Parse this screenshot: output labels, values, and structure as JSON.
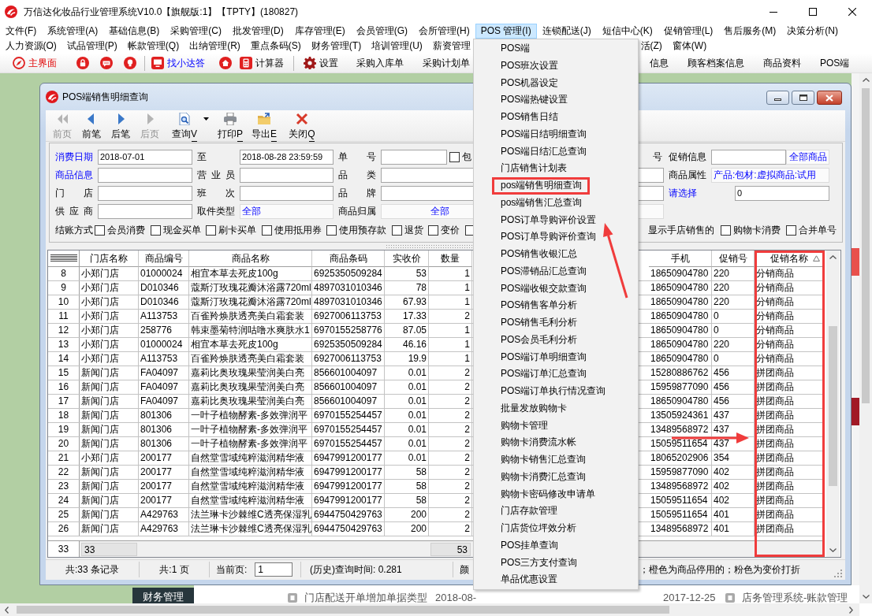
{
  "window": {
    "title": "万信达化妆品行业管理系统V10.0【旗舰版:1】【TPTY】(180827)"
  },
  "menu_bar": [
    {
      "label": "文件(F)",
      "selected": false
    },
    {
      "label": "系统管理(A)",
      "selected": false
    },
    {
      "label": "基础信息(B)",
      "selected": false
    },
    {
      "label": "采购管理(C)",
      "selected": false
    },
    {
      "label": "批发管理(D)",
      "selected": false
    },
    {
      "label": "库存管理(E)",
      "selected": false
    },
    {
      "label": "会员管理(G)",
      "selected": false
    },
    {
      "label": "会所管理(H)",
      "selected": false
    },
    {
      "label": "POS 管理(I)",
      "selected": true
    },
    {
      "label": "连锁配送(J)",
      "selected": false
    },
    {
      "label": "短信中心(K)",
      "selected": false
    },
    {
      "label": "促销管理(L)",
      "selected": false
    },
    {
      "label": "售后服务(M)",
      "selected": false
    },
    {
      "label": "决策分析(N)",
      "selected": false
    }
  ],
  "menu_bar_row_2": {
    "left": [
      "人力资源(O)",
      "试品管理(P)",
      "帐款管理(Q)",
      "出纳管理(R)",
      "重点条码(S)",
      "财务管理(T)",
      "培训管理(U)",
      "薪资管理"
    ],
    "right": [
      "活(Z)",
      "窗体(W)"
    ]
  },
  "toolbar": {
    "left": [
      {
        "kind": "icon_label",
        "label": "主界面"
      },
      {
        "kind": "icon"
      },
      {
        "kind": "icon"
      },
      {
        "kind": "icon"
      },
      {
        "kind": "separator"
      },
      {
        "kind": "icon_label",
        "label": "找小达答"
      },
      {
        "kind": "icon"
      },
      {
        "kind": "icon_label",
        "label": "计算器"
      },
      {
        "kind": "separator"
      },
      {
        "kind": "icon_label",
        "label": "设置"
      },
      {
        "kind": "label",
        "label": "采购入库单"
      },
      {
        "kind": "label",
        "label": "采购计划单"
      }
    ],
    "right": [
      {
        "kind": "label",
        "label": "信息"
      },
      {
        "kind": "label",
        "label": "顾客档案信息"
      },
      {
        "kind": "label",
        "label": "商品资料"
      },
      {
        "kind": "label",
        "label": "POS端"
      }
    ]
  },
  "pos_menu": [
    {
      "label": "POS端",
      "marked": false
    },
    {
      "label": "POS班次设置",
      "marked": false
    },
    {
      "label": "POS机器设定",
      "marked": false
    },
    {
      "label": "POS端热键设置",
      "marked": false
    },
    {
      "label": "POS销售日结",
      "marked": false
    },
    {
      "label": "POS端日结明细查询",
      "marked": false
    },
    {
      "label": "POS端日结汇总查询",
      "marked": false
    },
    {
      "label": "门店销售计划表",
      "marked": false
    },
    {
      "label": "pos端销售明细查询",
      "marked": true
    },
    {
      "label": "pos端销售汇总查询",
      "marked": false
    },
    {
      "label": "POS订单导购评价设置",
      "marked": false
    },
    {
      "label": "POS订单导购评价查询",
      "marked": false
    },
    {
      "label": "POS销售收银汇总",
      "marked": false
    },
    {
      "label": "POS滞销品汇总查询",
      "marked": false
    },
    {
      "label": "POS端收银交款查询",
      "marked": false
    },
    {
      "label": "POS销售客单分析",
      "marked": false
    },
    {
      "label": "POS销售毛利分析",
      "marked": false
    },
    {
      "label": "POS会员毛利分析",
      "marked": false
    },
    {
      "label": "POS端订单明细查询",
      "marked": false
    },
    {
      "label": "POS端订单汇总查询",
      "marked": false
    },
    {
      "label": "POS端订单执行情况查询",
      "marked": false
    },
    {
      "label": "批量发放购物卡",
      "marked": false
    },
    {
      "label": "购物卡管理",
      "marked": false
    },
    {
      "label": "购物卡消费流水帐",
      "marked": false
    },
    {
      "label": "购物卡销售汇总查询",
      "marked": false
    },
    {
      "label": "购物卡消费汇总查询",
      "marked": false
    },
    {
      "label": "购物卡密码修改申请单",
      "marked": false
    },
    {
      "label": "门店存款管理",
      "marked": false
    },
    {
      "label": "门店货位坪效分析",
      "marked": false
    },
    {
      "label": "POS挂单查询",
      "marked": false
    },
    {
      "label": "POS三方支付查询",
      "marked": false
    },
    {
      "label": "单品优惠设置",
      "marked": false
    }
  ],
  "query_window": {
    "title": "POS端销售明细查询",
    "toolbar": [
      {
        "label": "前页",
        "disabled": true,
        "dropdown": false
      },
      {
        "label": "前笔",
        "disabled": false,
        "dropdown": false
      },
      {
        "label": "后笔",
        "disabled": false,
        "dropdown": false
      },
      {
        "label": "后页",
        "disabled": true,
        "dropdown": false
      },
      {
        "label": "查询",
        "hotkey": "V",
        "disabled": false,
        "dropdown": true
      },
      {
        "label": "打印",
        "hotkey": "P",
        "disabled": false,
        "dropdown": false
      },
      {
        "label": "导出",
        "hotkey": "E",
        "disabled": false,
        "dropdown": false
      },
      {
        "label": "关闭",
        "hotkey": "Q",
        "disabled": false,
        "dropdown": false
      }
    ],
    "filters": {
      "rows": [
        {
          "fields": [
            {
              "label": "消费日期",
              "link": true,
              "kind": "input",
              "value": "2018-07-01"
            },
            {
              "label": "至",
              "link": false,
              "kind": "input",
              "value": "2018-08-28 23:59:59"
            },
            {
              "label": "单 号",
              "link": false,
              "kind": "input"
            }
          ],
          "checkbox": {
            "label": "包",
            "checked": false
          },
          "tail": "号",
          "right": {
            "label": "促销信息",
            "link": false,
            "kind": "input",
            "button": "全部商品"
          }
        },
        {
          "fields": [
            {
              "label": "商品信息",
              "link": true,
              "kind": "input"
            },
            {
              "label": "营 业 员",
              "link": false,
              "kind": "input"
            },
            {
              "label": "品 类",
              "link": false,
              "kind": "input"
            }
          ],
          "right": {
            "label": "商品属性",
            "link": false,
            "kind": "select",
            "value": "产品:包材:虚拟商品:试用"
          }
        },
        {
          "fields": [
            {
              "label": "门 店",
              "link": false,
              "kind": "input"
            },
            {
              "label": "班 次",
              "link": false,
              "kind": "input"
            },
            {
              "label": "品 牌",
              "link": false,
              "kind": "input"
            }
          ],
          "right": {
            "label": "请选择",
            "link": true,
            "kind": "input",
            "value": "0"
          }
        },
        {
          "fields": [
            {
              "label": "供 应 商",
              "link": false,
              "kind": "input"
            },
            {
              "label": "取件类型",
              "link": false,
              "kind": "select",
              "value": "全部"
            },
            {
              "label": "商品归属",
              "link": false,
              "kind": "select",
              "value": "全部"
            }
          ]
        }
      ],
      "payment": {
        "label": "结账方式",
        "options": [
          {
            "label": "会员消费",
            "checked": false
          },
          {
            "label": "现金买单",
            "checked": false
          },
          {
            "label": "刷卡买单",
            "checked": false
          },
          {
            "label": "使用抵用券",
            "checked": false
          },
          {
            "label": "使用预存款",
            "checked": false
          },
          {
            "label": "退货",
            "checked": false
          },
          {
            "label": "变价",
            "checked": false
          },
          {
            "checked": false
          }
        ]
      },
      "extra": {
        "label": "显示手店销售的",
        "options": [
          {
            "label": "购物卡消费",
            "checked": false
          },
          {
            "label": "合并单号",
            "checked": false
          }
        ]
      }
    },
    "table": {
      "columns": [
        {
          "label": "门店名称",
          "kind": "text",
          "sorted": false,
          "marked": false
        },
        {
          "label": "商品编号",
          "kind": "text",
          "sorted": false,
          "marked": false
        },
        {
          "label": "商品名称",
          "kind": "text",
          "sorted": false,
          "marked": false
        },
        {
          "label": "商品条码",
          "kind": "text",
          "sorted": false,
          "marked": false
        },
        {
          "label": "实收价",
          "kind": "number",
          "sorted": false,
          "marked": false
        },
        {
          "label": "数量",
          "kind": "number",
          "sorted": false,
          "marked": false
        },
        {
          "label": "手机",
          "kind": "text",
          "sorted": false,
          "marked": false
        },
        {
          "label": "促销号",
          "kind": "text",
          "sorted": false,
          "marked": false
        },
        {
          "label": "促销名称",
          "kind": "text",
          "sorted": true,
          "marked": true
        }
      ],
      "rows": [
        {
          "number": "8",
          "cells": [
            "小郑门店",
            "01000024",
            "相宜本草去死皮100g",
            "6925350509284",
            "53",
            "1",
            "18650904780",
            "220",
            "分销商品"
          ]
        },
        {
          "number": "9",
          "cells": [
            "小郑门店",
            "D010346",
            "蔻斯汀玫瑰花瓣沐浴露720ml",
            "4897031010346",
            "78",
            "1",
            "18650904780",
            "220",
            "分销商品"
          ]
        },
        {
          "number": "10",
          "cells": [
            "小郑门店",
            "D010346",
            "蔻斯汀玫瑰花瓣沐浴露720ml",
            "4897031010346",
            "67.93",
            "1",
            "18650904780",
            "220",
            "分销商品"
          ]
        },
        {
          "number": "11",
          "cells": [
            "小郑门店",
            "A113753",
            "百雀羚焕肤透亮美白霜套装",
            "6927006113753",
            "17.33",
            "2",
            "18650904780",
            "0",
            "分销商品"
          ]
        },
        {
          "number": "12",
          "cells": [
            "小郑门店",
            "258776",
            "韩束墨菊特润咕噜水爽肤水1",
            "6970155258776",
            "87.05",
            "1",
            "18650904780",
            "0",
            "分销商品"
          ]
        },
        {
          "number": "13",
          "cells": [
            "小郑门店",
            "01000024",
            "相宜本草去死皮100g",
            "6925350509284",
            "46.16",
            "1",
            "18650904780",
            "220",
            "分销商品"
          ]
        },
        {
          "number": "14",
          "cells": [
            "小郑门店",
            "A113753",
            "百雀羚焕肤透亮美白霜套装",
            "6927006113753",
            "19.9",
            "1",
            "18650904780",
            "0",
            "分销商品"
          ]
        },
        {
          "number": "15",
          "cells": [
            "新闻门店",
            "FA04097",
            "嘉莉比奥玫瑰果莹润美白亮",
            "856601004097",
            "0.01",
            "2",
            "15280886762",
            "456",
            "拼团商品"
          ]
        },
        {
          "number": "16",
          "cells": [
            "新闻门店",
            "FA04097",
            "嘉莉比奥玫瑰果莹润美白亮",
            "856601004097",
            "0.01",
            "2",
            "15959877090",
            "456",
            "拼团商品"
          ]
        },
        {
          "number": "17",
          "cells": [
            "新闻门店",
            "FA04097",
            "嘉莉比奥玫瑰果莹润美白亮",
            "856601004097",
            "0.01",
            "2",
            "18650904780",
            "456",
            "拼团商品"
          ]
        },
        {
          "number": "18",
          "cells": [
            "新闻门店",
            "801306",
            "一叶子植物酵素-多效弹润平",
            "6970155254457",
            "0.01",
            "2",
            "13505924361",
            "437",
            "拼团商品"
          ]
        },
        {
          "number": "19",
          "cells": [
            "新闻门店",
            "801306",
            "一叶子植物酵素-多效弹润平",
            "6970155254457",
            "0.01",
            "2",
            "13489568972",
            "437",
            "拼团商品"
          ]
        },
        {
          "number": "20",
          "cells": [
            "新闻门店",
            "801306",
            "一叶子植物酵素-多效弹润平",
            "6970155254457",
            "0.01",
            "2",
            "15059511654",
            "437",
            "拼团商品"
          ]
        },
        {
          "number": "21",
          "cells": [
            "小郑门店",
            "200177",
            "自然堂雪域纯粹滋润精华液",
            "6947991200177",
            "0.01",
            "2",
            "18065202906",
            "354",
            "拼团商品"
          ]
        },
        {
          "number": "22",
          "cells": [
            "新闻门店",
            "200177",
            "自然堂雪域纯粹滋润精华液",
            "6947991200177",
            "58",
            "2",
            "15959877090",
            "402",
            "拼团商品"
          ]
        },
        {
          "number": "23",
          "cells": [
            "新闻门店",
            "200177",
            "自然堂雪域纯粹滋润精华液",
            "6947991200177",
            "58",
            "2",
            "13489568972",
            "402",
            "拼团商品"
          ]
        },
        {
          "number": "24",
          "cells": [
            "新闻门店",
            "200177",
            "自然堂雪域纯粹滋润精华液",
            "6947991200177",
            "58",
            "2",
            "15059511654",
            "402",
            "拼团商品"
          ]
        },
        {
          "number": "25",
          "cells": [
            "新闻门店",
            "A429763",
            "法兰琳卡沙棘维C透亮保湿乳",
            "6944750429763",
            "200",
            "2",
            "15059511654",
            "401",
            "拼团商品"
          ]
        },
        {
          "number": "26",
          "cells": [
            "新闻门店",
            "A429763",
            "法兰琳卡沙棘维C透亮保湿乳",
            "6944750429763",
            "200",
            "2",
            "13489568972",
            "401",
            "拼团商品"
          ]
        }
      ],
      "footer": {
        "number": "33",
        "store": "33",
        "quantity": "53"
      }
    },
    "status_bar": {
      "records": "共:33 条记录",
      "pages": "共:1 页",
      "page_label": "当前页:",
      "page": "1",
      "query_time": "(历史)查询时间: 0.281",
      "legend_start": "颜",
      "legend_end": "；橙色为商品停用的；粉色为变价打折"
    }
  },
  "desktop": {
    "tile": "财务管理",
    "news": [
      {
        "title": "门店配送开单增加单据类型",
        "date": "2018-08-"
      },
      {
        "date": "2017-12-25"
      },
      {
        "title": "店务管理系统-账款管理"
      }
    ]
  }
}
